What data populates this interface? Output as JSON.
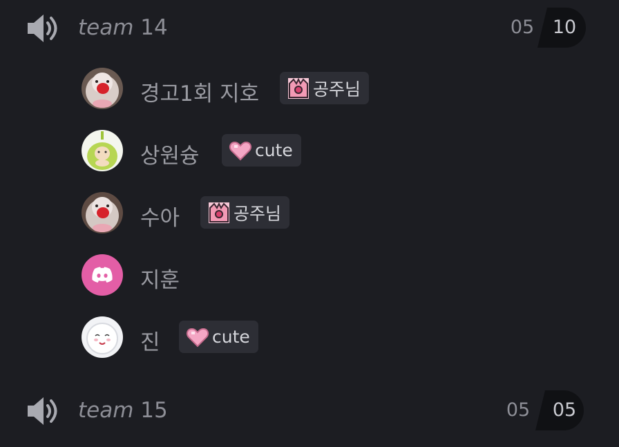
{
  "channels": [
    {
      "name_italic": "team",
      "name_number": "14",
      "icon": "speaker-icon",
      "users_connected": "05",
      "user_limit": "10"
    },
    {
      "name_italic": "team",
      "name_number": "15",
      "icon": "speaker-icon",
      "users_connected": "05",
      "user_limit": "05"
    }
  ],
  "members": [
    {
      "name": "경고1회 지호",
      "avatar": "avatar-pig-doll",
      "badge": {
        "icon": "crown-icon",
        "label": "공주님"
      }
    },
    {
      "name": "상원슝",
      "avatar": "avatar-green-character",
      "badge": {
        "icon": "heart-icon",
        "label": "cute"
      }
    },
    {
      "name": "수아",
      "avatar": "avatar-pig-doll",
      "badge": {
        "icon": "crown-icon",
        "label": "공주님"
      }
    },
    {
      "name": "지훈",
      "avatar": "discord-default-avatar",
      "badge": null
    },
    {
      "name": "진",
      "avatar": "avatar-white-character",
      "badge": {
        "icon": "heart-icon",
        "label": "cute"
      }
    }
  ],
  "colors": {
    "background": "#1c1d22",
    "badge_background": "#2d2e35",
    "counter_limit_background": "#101114",
    "discord_avatar_pink": "#e35ea6",
    "text_muted": "#8d8e96"
  }
}
